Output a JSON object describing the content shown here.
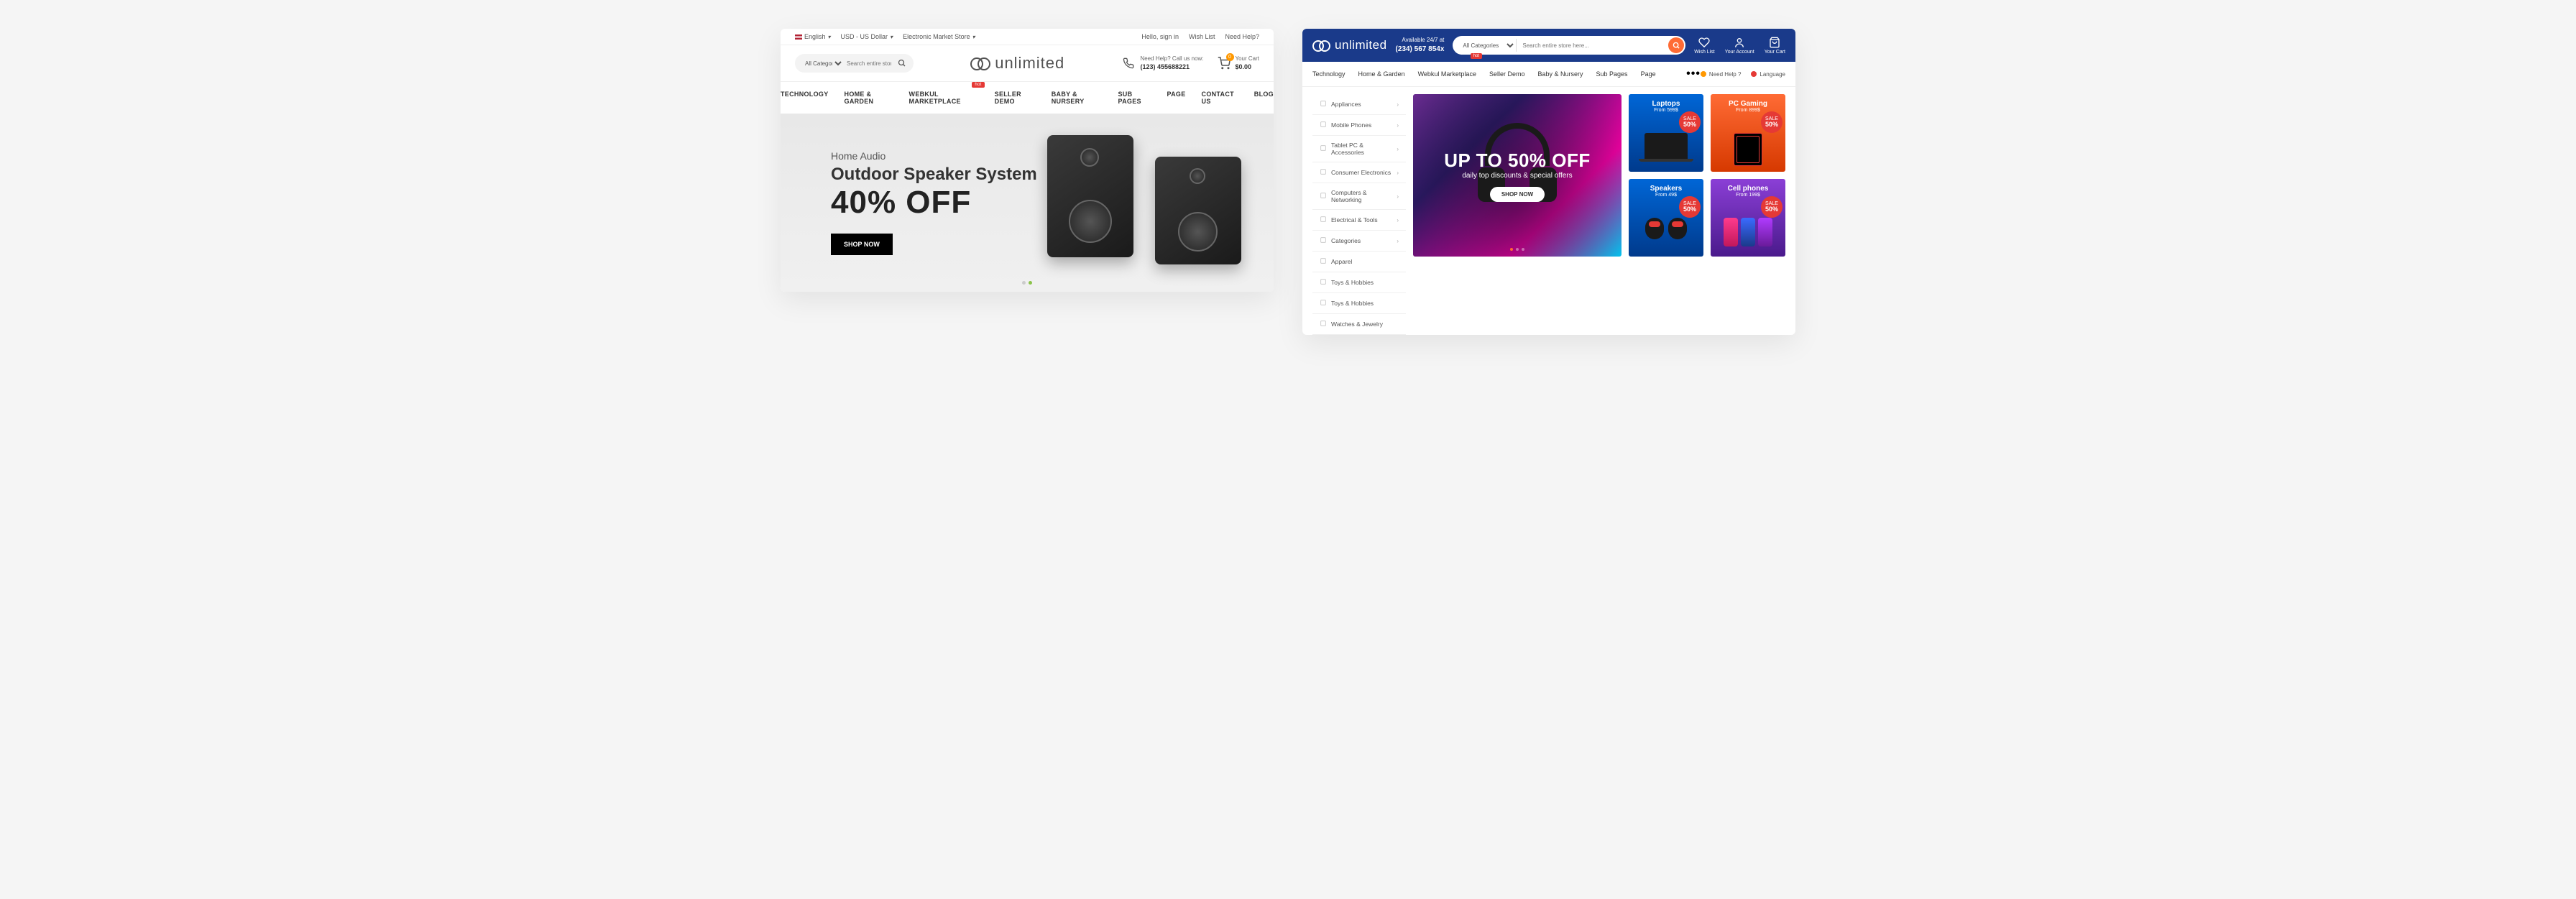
{
  "left": {
    "topbar": {
      "language": "English",
      "currency": "USD - US Dollar",
      "store": "Electronic Market Store",
      "hello": "Hello, sign in",
      "wishlist": "Wish List",
      "help": "Need Help?"
    },
    "header": {
      "categories_label": "All Categories",
      "search_placeholder": "Search entire store here",
      "logo_text": "unlimited",
      "phone_label": "Need Help? Call us now:",
      "phone_number": "(123) 455688221",
      "cart_label": "Your Cart",
      "cart_value": "$0.00",
      "cart_count": "0"
    },
    "nav": [
      "TECHNOLOGY",
      "HOME & GARDEN",
      "WEBKUL MARKETPLACE",
      "SELLER DEMO",
      "BABY & NURSERY",
      "SUB PAGES",
      "PAGE",
      "CONTACT US",
      "BLOG"
    ],
    "nav_hot_index": 2,
    "hot_label": "hot",
    "hero": {
      "eyebrow": "Home Audio",
      "title": "Outdoor Speaker System",
      "headline": "40% OFF",
      "cta": "SHOP NOW"
    }
  },
  "right": {
    "header": {
      "logo_text": "unlimited",
      "avail_label": "Available 24/7 at",
      "avail_phone": "(234) 567 854x",
      "categories_label": "All Categories",
      "search_placeholder": "Search entire store here...",
      "wishlist": "Wish List",
      "account": "Your Account",
      "cart": "Your Cart"
    },
    "nav": [
      "Technology",
      "Home & Garden",
      "Webkul Marketplace",
      "Seller Demo",
      "Baby & Nursery",
      "Sub Pages",
      "Page"
    ],
    "nav_hot_index": 2,
    "hot_label": "hot",
    "nav_help": "Need Help ?",
    "nav_language": "Language",
    "sidebar": [
      {
        "label": "Appliances",
        "arrow": true
      },
      {
        "label": "Mobile Phones",
        "arrow": true
      },
      {
        "label": "Tablet PC & Accessories",
        "arrow": true
      },
      {
        "label": "Consumer Electronics",
        "arrow": true
      },
      {
        "label": "Computers & Networking",
        "arrow": true
      },
      {
        "label": "Electrical & Tools",
        "arrow": true
      },
      {
        "label": "Categories",
        "arrow": true
      },
      {
        "label": "Apparel",
        "arrow": false
      },
      {
        "label": "Toys & Hobbies",
        "arrow": false
      },
      {
        "label": "Toys & Hobbies",
        "arrow": false
      },
      {
        "label": "Watches & Jewelry",
        "arrow": false
      }
    ],
    "hero": {
      "headline": "UP TO 50% OFF",
      "sub": "daily top discounts & special offers",
      "cta": "SHOP NOW"
    },
    "promos": [
      {
        "title": "Laptops",
        "sub": "From 599$",
        "sale_label": "SALE",
        "sale_value": "50%"
      },
      {
        "title": "PC Gaming",
        "sub": "From 899$",
        "sale_label": "SALE",
        "sale_value": "50%"
      },
      {
        "title": "Speakers",
        "sub": "From 49$",
        "sale_label": "SALE",
        "sale_value": "50%"
      },
      {
        "title": "Cell phones",
        "sub": "From 199$",
        "sale_label": "SALE",
        "sale_value": "50%"
      }
    ]
  }
}
